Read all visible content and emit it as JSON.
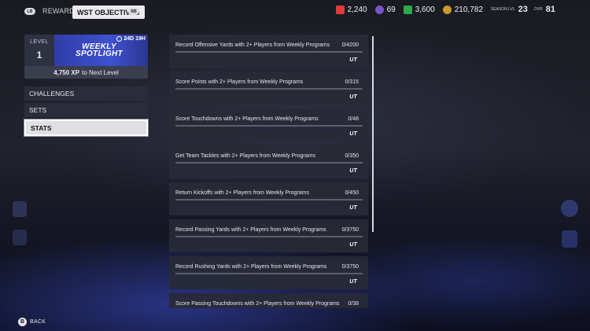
{
  "header": {
    "lb_label": "LB",
    "rb_label": "RB",
    "tabs": [
      {
        "label": "REWARDS",
        "active": false
      },
      {
        "label": "WST OBJECTIVES",
        "active": true
      }
    ],
    "currencies": [
      {
        "icon": "coins-icon",
        "value": "2,240",
        "color": "#e23a3a"
      },
      {
        "icon": "points-icon",
        "value": "69",
        "color": "#7a55c7"
      },
      {
        "icon": "training-icon",
        "value": "3,600",
        "color": "#2fa84a"
      },
      {
        "icon": "mut-coin-icon",
        "value": "210,782",
        "color": "#c89a2a"
      }
    ],
    "season_lvl_label": "SEASON LVL",
    "season_lvl": "23",
    "ovr_label": "OVR",
    "ovr": "81"
  },
  "level_card": {
    "level_label": "LEVEL",
    "level": "1",
    "banner_title": "WEEKLY SPOTLIGHT",
    "timer": "24D 19H",
    "xp_value": "4,750 XP",
    "xp_suffix": "to Next Level"
  },
  "menu": [
    {
      "label": "CHALLENGES",
      "active": false
    },
    {
      "label": "SETS",
      "active": false
    },
    {
      "label": "STATS",
      "active": true
    }
  ],
  "objectives": [
    {
      "name": "Record Offensive Yards with 2+ Players from Weekly Programs",
      "progress": "0/4200",
      "fraction": 0,
      "badge": "UT"
    },
    {
      "name": "Score Points with 2+ Players from Weekly Programs",
      "progress": "0/315",
      "fraction": 0,
      "badge": "UT"
    },
    {
      "name": "Score Touchdowns with 2+ Players from Weekly Programs",
      "progress": "0/48",
      "fraction": 0,
      "badge": "UT"
    },
    {
      "name": "Get Team Tackles with 2+ Players from Weekly Programs",
      "progress": "0/350",
      "fraction": 0,
      "badge": "UT"
    },
    {
      "name": "Return Kickoffs with 2+ Players from Weekly Programs",
      "progress": "0/450",
      "fraction": 0,
      "badge": "UT"
    },
    {
      "name": "Record Passing Yards with 2+ Players from Weekly Programs",
      "progress": "0/3750",
      "fraction": 0,
      "badge": "UT"
    },
    {
      "name": "Record Rushing Yards with 2+ Players from Weekly Programs",
      "progress": "0/3750",
      "fraction": 0,
      "badge": "UT"
    },
    {
      "name": "Score Passing Touchdowns with 2+ Players from Weekly Programs",
      "progress": "0/38",
      "fraction": 0,
      "badge": "UT"
    }
  ],
  "footer": {
    "back_button": "B",
    "back_label": "BACK"
  }
}
